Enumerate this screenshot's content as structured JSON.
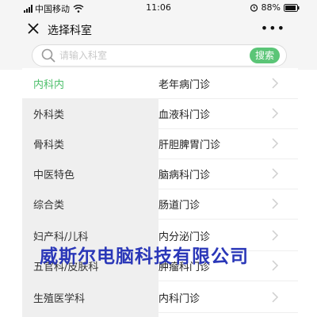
{
  "status_bar": {
    "carrier": "中国移动",
    "time": "11:06",
    "battery": "88%"
  },
  "header": {
    "title": "选择科室"
  },
  "search": {
    "placeholder": "请输入科室",
    "button_label": "搜索"
  },
  "categories": [
    {
      "label": "内科内",
      "active": true
    },
    {
      "label": "外科类"
    },
    {
      "label": "骨科类"
    },
    {
      "label": "中医特色"
    },
    {
      "label": "综合类"
    },
    {
      "label": "妇产科/儿科"
    },
    {
      "label": "五官科/皮肤科"
    },
    {
      "label": "生殖医学科"
    }
  ],
  "clinics": [
    {
      "label": "老年病门诊"
    },
    {
      "label": "血液科门诊"
    },
    {
      "label": "肝胆脾胃门诊"
    },
    {
      "label": "脑病科门诊"
    },
    {
      "label": "肠道门诊"
    },
    {
      "label": "内分泌门诊"
    },
    {
      "label": "肿瘤科门诊"
    },
    {
      "label": "内科门诊"
    }
  ],
  "watermark": "威斯尔电脑科技有限公司",
  "colors": {
    "accent": "#5bc577",
    "active_text": "#4cbf6a",
    "watermark": "#2a37b8"
  }
}
